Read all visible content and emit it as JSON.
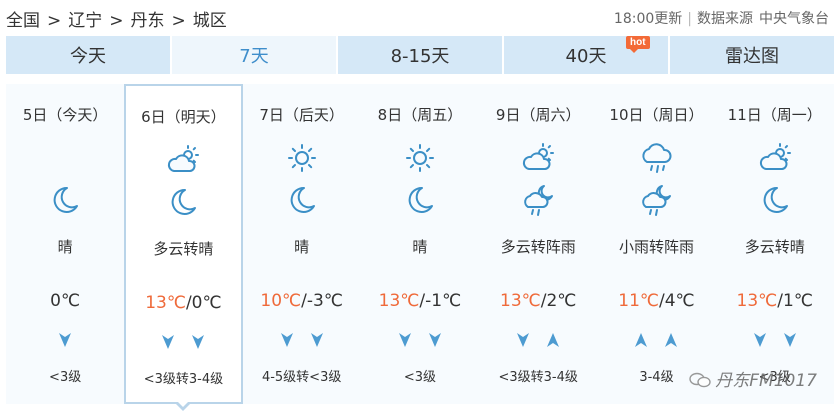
{
  "breadcrumb": [
    {
      "label": "全国"
    },
    {
      "label": "辽宁"
    },
    {
      "label": "丹东"
    },
    {
      "label": "城区"
    }
  ],
  "breadcrumb_separator": ">",
  "meta": {
    "update_time": "18:00更新",
    "source_label": "数据来源",
    "source_name": "中央气象台"
  },
  "tabs": [
    {
      "label": "今天",
      "active": false
    },
    {
      "label": "7天",
      "active": true
    },
    {
      "label": "8-15天",
      "active": false
    },
    {
      "label": "40天",
      "active": false,
      "badge": "hot"
    },
    {
      "label": "雷达图",
      "active": false
    }
  ],
  "forecast": [
    {
      "date": "5日（今天）",
      "day_icon": "",
      "night_icon": "moon-icon",
      "desc": "晴",
      "high": "",
      "low": "0℃",
      "wind_dirs": [
        "down"
      ],
      "wind_level": "<3级"
    },
    {
      "date": "6日（明天）",
      "day_icon": "partly-cloudy-icon",
      "night_icon": "moon-icon",
      "desc": "多云转晴",
      "high": "13℃",
      "low": "0℃",
      "wind_dirs": [
        "down",
        "down"
      ],
      "wind_level": "<3级转3-4级",
      "selected": true
    },
    {
      "date": "7日（后天）",
      "day_icon": "sun-icon",
      "night_icon": "moon-icon",
      "desc": "晴",
      "high": "10℃",
      "low": "-3℃",
      "wind_dirs": [
        "down",
        "down"
      ],
      "wind_level": "4-5级转<3级"
    },
    {
      "date": "8日（周五）",
      "day_icon": "sun-icon",
      "night_icon": "moon-icon",
      "desc": "晴",
      "high": "13℃",
      "low": "-1℃",
      "wind_dirs": [
        "down",
        "down"
      ],
      "wind_level": "<3级"
    },
    {
      "date": "9日（周六）",
      "day_icon": "partly-cloudy-icon",
      "night_icon": "night-shower-icon",
      "desc": "多云转阵雨",
      "high": "13℃",
      "low": "2℃",
      "wind_dirs": [
        "down",
        "up"
      ],
      "wind_level": "<3级转3-4级"
    },
    {
      "date": "10日（周日）",
      "day_icon": "rain-icon",
      "night_icon": "night-shower-icon",
      "desc": "小雨转阵雨",
      "high": "11℃",
      "low": "4℃",
      "wind_dirs": [
        "up",
        "up"
      ],
      "wind_level": "3-4级"
    },
    {
      "date": "11日（周一）",
      "day_icon": "partly-cloudy-icon",
      "night_icon": "moon-icon",
      "desc": "多云转晴",
      "high": "13℃",
      "low": "1℃",
      "wind_dirs": [
        "down",
        "down"
      ],
      "wind_level": "<3级"
    }
  ],
  "colors": {
    "accent": "#3f8ecb",
    "high_temp": "#ef6a3a",
    "tab_bg": "#d5e8f7",
    "hot_badge": "#f36a37"
  },
  "watermark": "丹东FM1017"
}
